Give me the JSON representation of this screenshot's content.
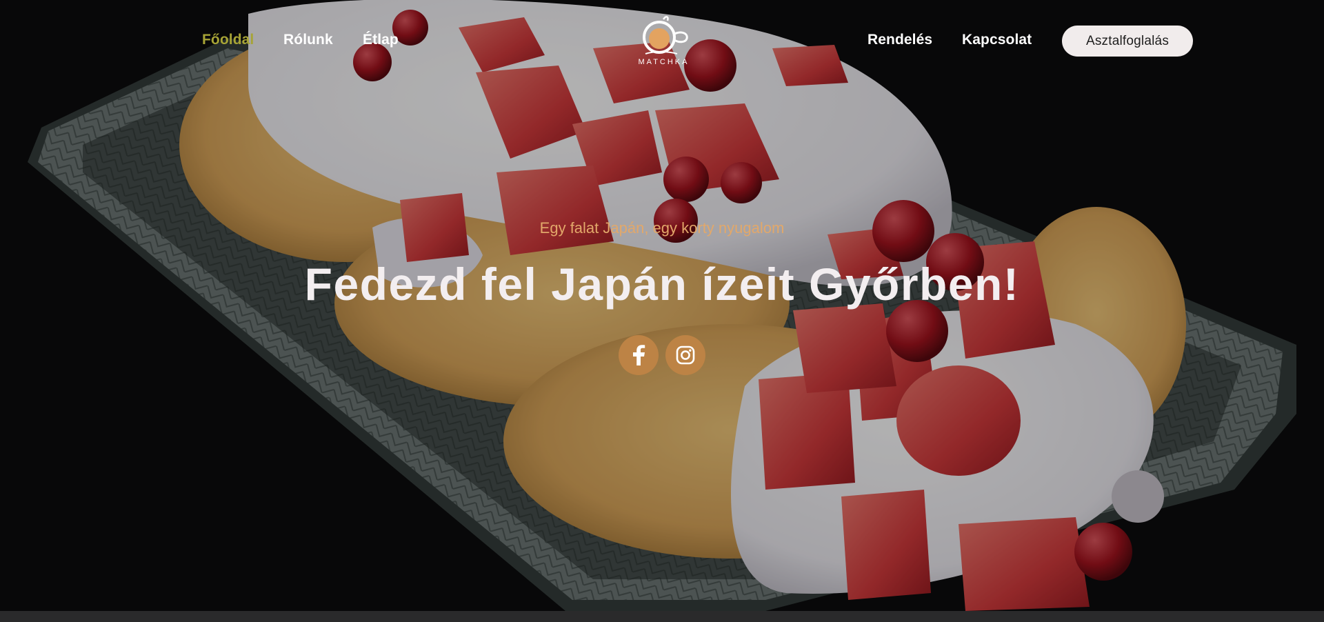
{
  "nav": {
    "left": [
      {
        "label": "Főoldal",
        "active": true
      },
      {
        "label": "Rólunk",
        "active": false
      },
      {
        "label": "Étlap",
        "active": false
      }
    ],
    "right": [
      {
        "label": "Rendelés",
        "active": false
      },
      {
        "label": "Kapcsolat",
        "active": false
      }
    ],
    "reserve_label": "Asztalfoglalás",
    "active_color": "#a7a436"
  },
  "logo": {
    "text": "MATCHKA",
    "icon": "tea-cup-icon",
    "accent": "#e3a360"
  },
  "hero": {
    "tagline": "Egy falat Japán, egy korty nyugalom",
    "headline": "Fedezd fel Japán ízeit Győrben!",
    "image": "pancakes-with-strawberries-and-cream-photo",
    "tagline_color": "#e2a86a"
  },
  "social": [
    {
      "icon": "facebook-icon"
    },
    {
      "icon": "instagram-icon"
    }
  ],
  "colors": {
    "social_button": "#bd8345",
    "reserve_button_bg": "#f1ecec",
    "background": "#0f0f10"
  }
}
